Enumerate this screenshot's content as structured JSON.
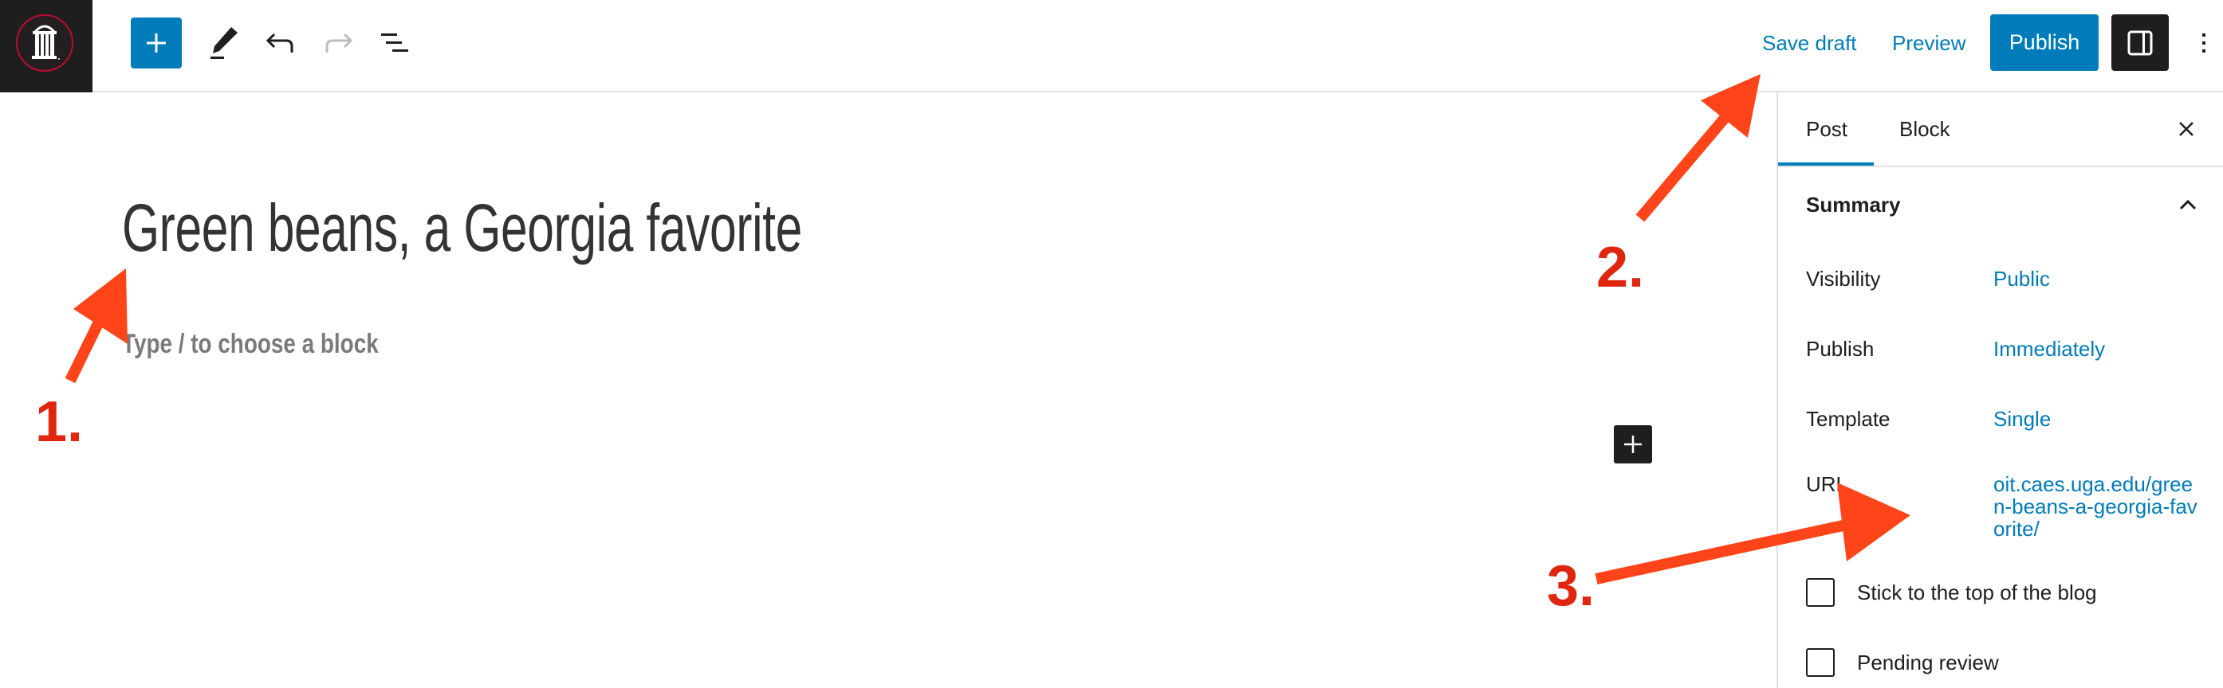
{
  "header": {
    "logo": "university-arch-logo",
    "toolbar": {
      "inserter_label": "Add block",
      "tools_label": "Tools",
      "undo_label": "Undo",
      "redo_label": "Redo",
      "list_view_label": "Document overview"
    },
    "actions": {
      "save_draft": "Save draft",
      "preview": "Preview",
      "publish": "Publish",
      "settings_label": "Settings",
      "options_label": "Options"
    }
  },
  "editor": {
    "title": "Green beans, a Georgia favorite",
    "block_placeholder": "Type / to choose a block",
    "inline_inserter_label": "Add block"
  },
  "sidebar": {
    "tabs": [
      {
        "label": "Post",
        "active": true
      },
      {
        "label": "Block",
        "active": false
      }
    ],
    "close_label": "Close settings",
    "summary": {
      "title": "Summary",
      "expanded": true,
      "rows": [
        {
          "label": "Visibility",
          "value": "Public"
        },
        {
          "label": "Publish",
          "value": "Immediately"
        },
        {
          "label": "Template",
          "value": "Single"
        },
        {
          "label": "URL",
          "value": "oit.caes.uga.edu/green-beans-a-georgia-favorite/"
        }
      ],
      "checkboxes": [
        {
          "label": "Stick to the top of the blog",
          "checked": false
        },
        {
          "label": "Pending review",
          "checked": false
        }
      ]
    }
  },
  "annotations": [
    {
      "label": "1.",
      "target": "post-title"
    },
    {
      "label": "2.",
      "target": "save-draft-button"
    },
    {
      "label": "3.",
      "target": "url-value"
    }
  ],
  "colors": {
    "accent": "#007cba",
    "dark": "#1e1e1e",
    "arrow": "#ff4419",
    "annotation_label": "#e0260f",
    "logo_ring": "#ba0c2f"
  }
}
